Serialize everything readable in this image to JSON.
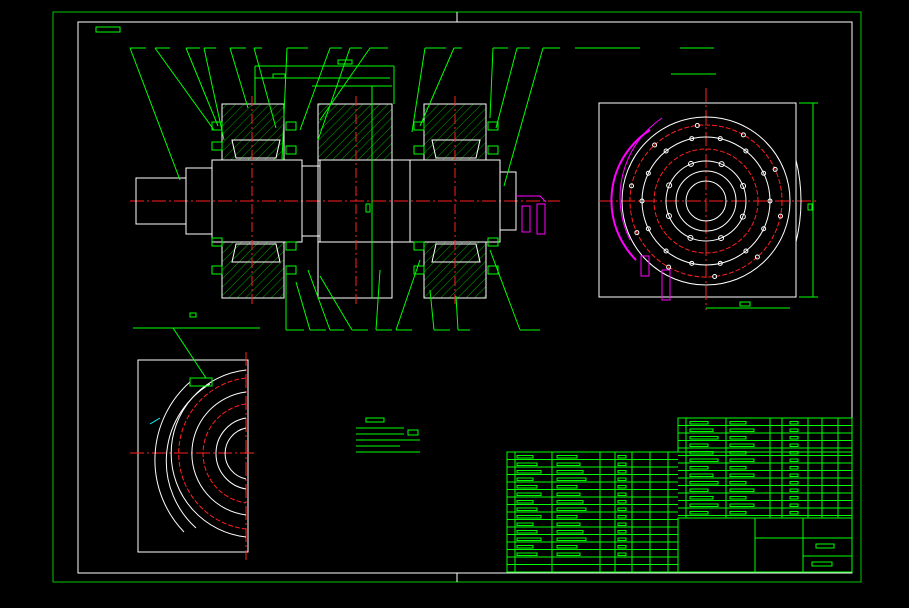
{
  "drawing": {
    "colors": {
      "background": "#000000",
      "frame": "#00c800",
      "outline": "#ffffff",
      "centerline": "#ff2020",
      "leader": "#00ff00",
      "annotation": "#ff00ff",
      "hatch": "#00a000",
      "accent": "#00ffff"
    },
    "views": [
      "main-section-view",
      "end-view",
      "partial-detail-view"
    ],
    "title_block": {
      "label_cells": 1
    }
  }
}
